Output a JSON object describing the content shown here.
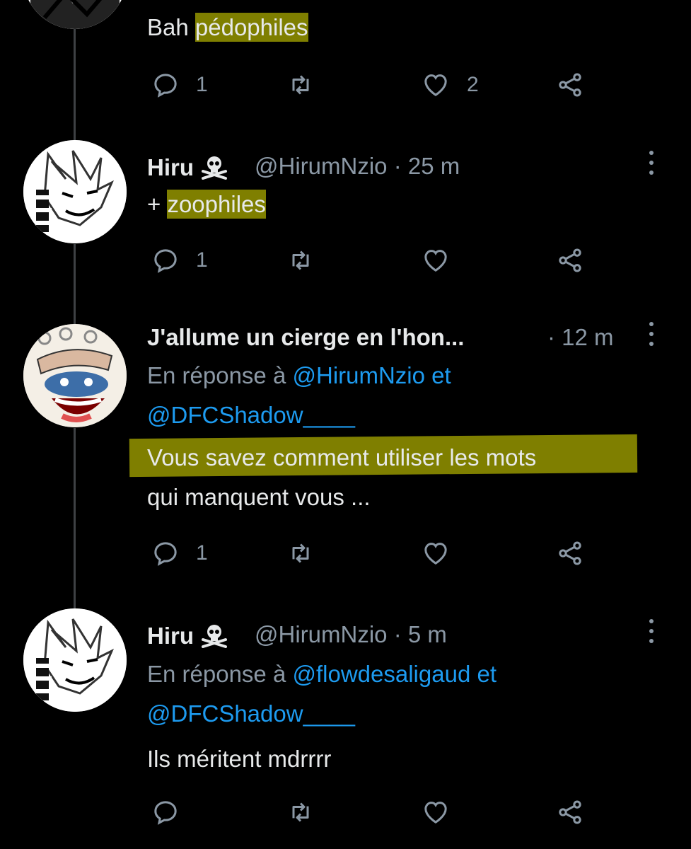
{
  "tweets": [
    {
      "text_prefix": "Bah ",
      "text_highlight": "pédophiles",
      "reply_count": "1",
      "like_count": "2"
    },
    {
      "name": "Hiru",
      "handle": "@HirumNzio",
      "time": "· 25 m",
      "text_prefix": "+ ",
      "text_highlight": "zoophiles",
      "reply_count": "1"
    },
    {
      "name": "J'allume un cierge en l'hon...",
      "time": "· 12 m",
      "reply_prefix": "En réponse à ",
      "reply_user1": "@HirumNzio",
      "reply_and": " et",
      "reply_user2": "@DFCShadow____",
      "text_line1": "Vous savez comment utiliser les mots",
      "text_line2": "qui manquent vous ...",
      "reply_count": "1"
    },
    {
      "name": "Hiru",
      "handle": "@HirumNzio",
      "time": "· 5 m",
      "reply_prefix": "En réponse à ",
      "reply_user1": "@flowdesaligaud",
      "reply_and": " et",
      "reply_user2": "@DFCShadow____",
      "text": "Ils méritent mdrrrr"
    }
  ],
  "icons": {
    "reply": "reply-bubble-icon",
    "retweet": "retweet-icon",
    "like": "heart-icon",
    "share": "share-icon",
    "more": "more-vertical-icon",
    "skull": "skull-crossbones-emoji"
  },
  "colors": {
    "background": "#000000",
    "text": "#e7e9ea",
    "secondary": "#8b98a5",
    "link": "#1d9bf0",
    "highlight": "#cdcd00"
  }
}
